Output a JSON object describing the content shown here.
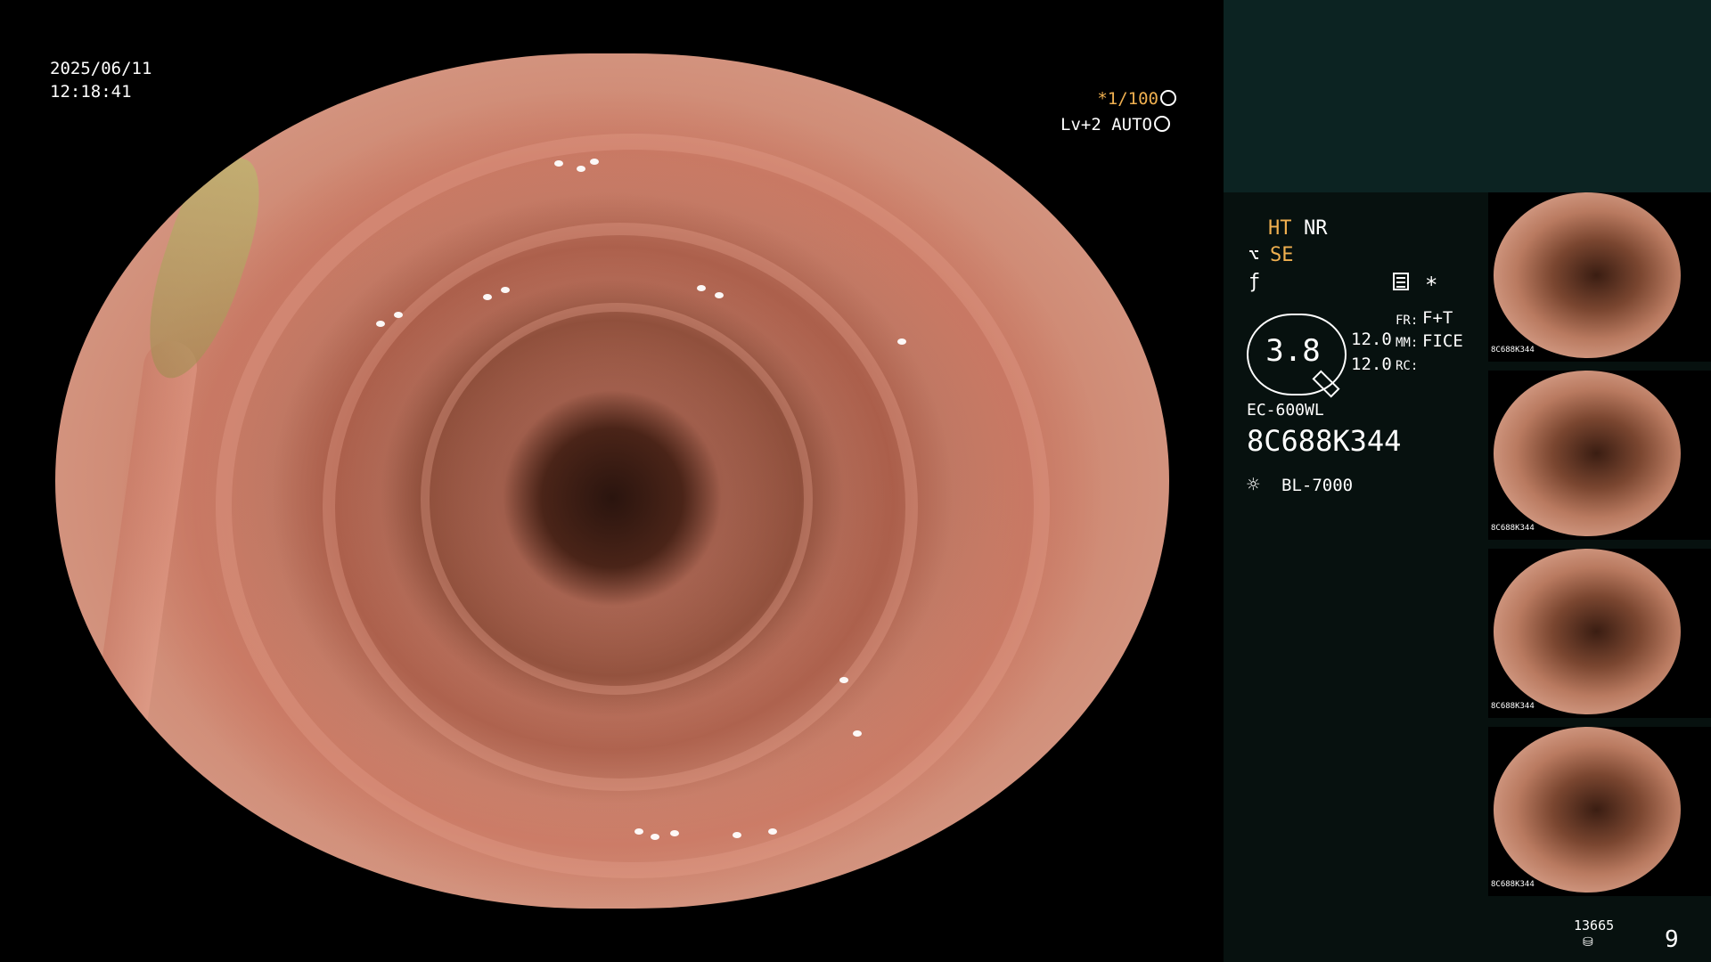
{
  "overlay": {
    "date": "2025/06/11",
    "time": "12:18:41",
    "shutter": "*1/100",
    "level": "Lv+2 AUTO"
  },
  "panel": {
    "ht": "HT",
    "nr": "NR",
    "se": "SE",
    "star": "*",
    "value_main": "3.8",
    "value_1": "12.0",
    "value_2": "12.0",
    "fr_label": "FR:",
    "fr_value": "F+T",
    "mm_label": "MM:",
    "mm_value": "FICE",
    "rc_label": "RC:",
    "model": "EC-600WL",
    "serial": "8C688K344",
    "light_source": "BL-7000",
    "counter": "13665",
    "page_number": "9"
  },
  "thumbnails": [
    {
      "label": "8C688K344"
    },
    {
      "label": "8C688K344"
    },
    {
      "label": "8C688K344"
    },
    {
      "label": "8C688K344"
    }
  ],
  "colors": {
    "accent_orange": "#f0b050",
    "panel_bg": "#07110f",
    "panel_top_bg": "#0c2322"
  },
  "icons": [
    "se-icon",
    "f-icon",
    "menu-icon",
    "star-icon",
    "pen-icon",
    "light-icon",
    "disk-icon",
    "shutter-icon",
    "auto-icon"
  ]
}
